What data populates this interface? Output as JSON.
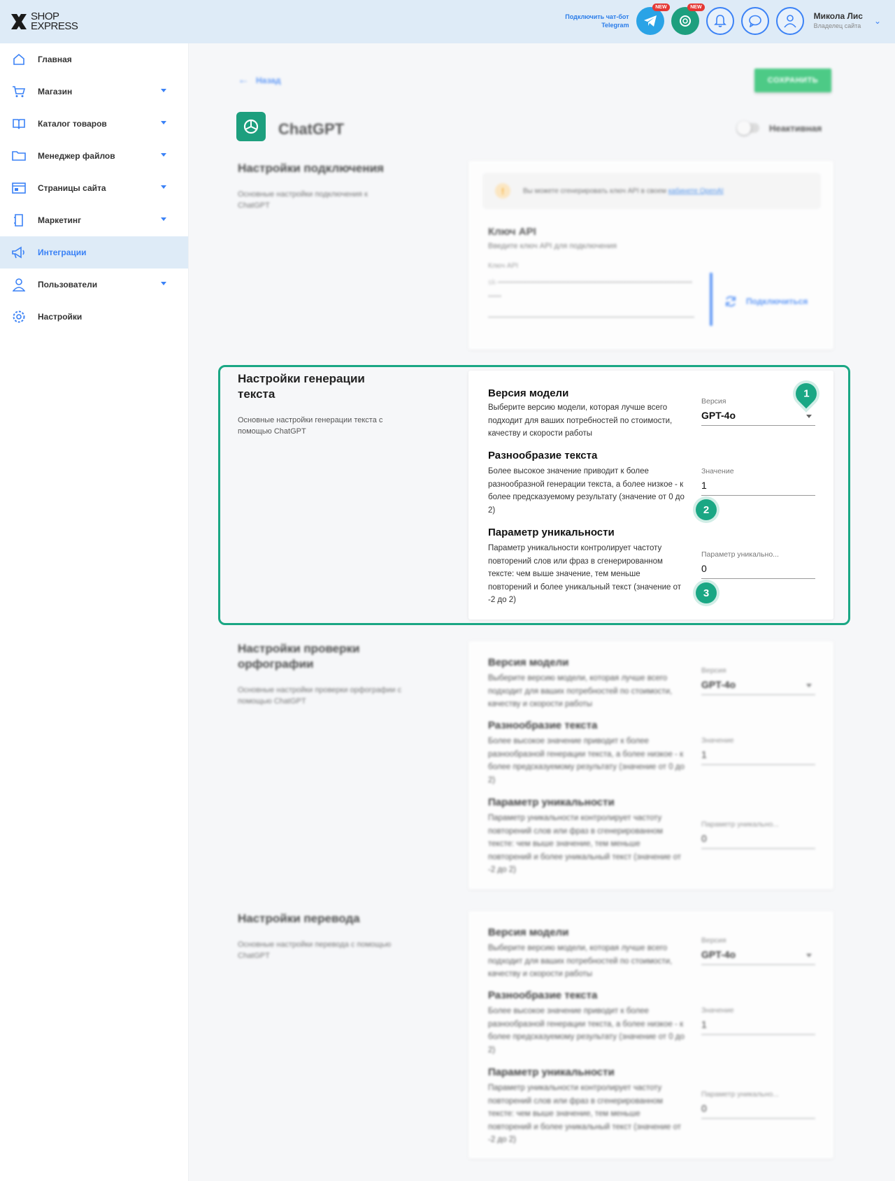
{
  "header": {
    "logo": "SHOP EXPRESS",
    "telegram_link": "Подключить чат-бот Telegram",
    "badge_new": "NEW",
    "user_name": "Микола Лис",
    "user_role": "Владелец сайта"
  },
  "sidebar": {
    "items": [
      {
        "label": "Главная",
        "icon": "home-icon"
      },
      {
        "label": "Магазин",
        "icon": "cart-icon"
      },
      {
        "label": "Каталог товаров",
        "icon": "catalog-icon"
      },
      {
        "label": "Менеджер файлов",
        "icon": "folder-icon"
      },
      {
        "label": "Страницы сайта",
        "icon": "page-icon"
      },
      {
        "label": "Маркетинг",
        "icon": "marketing-icon"
      },
      {
        "label": "Интеграции",
        "icon": "integration-icon"
      },
      {
        "label": "Пользователи",
        "icon": "users-icon"
      },
      {
        "label": "Настройки",
        "icon": "settings-icon"
      }
    ]
  },
  "page": {
    "back_label": "Назад",
    "save_label": "СОХРАНИТЬ",
    "app_title": "ChatGPT",
    "status_label": "Неактивная",
    "accent_color": "#1aa784"
  },
  "connection": {
    "title": "Настройки подключения",
    "desc": "Основные настройки подключения к ChatGPT",
    "info_text": "Вы можете сгенерировать ключ API в своем",
    "info_link": "кабинете OpenAI",
    "api_title": "Ключ API",
    "api_sub": "Введите ключ API для подключения",
    "api_label": "Ключ API",
    "api_value": "sk-•••••••••••••••••••••••••••••••••••••••••••••••••••••••••••••••••••••••••••••",
    "connect_label": "Подключиться"
  },
  "generation": {
    "title": "Настройки генерации текста",
    "desc": "Основные настройки генерации текста с помощью ChatGPT",
    "model_title": "Версия модели",
    "model_desc": "Выберите версию модели, которая лучше всего подходит для ваших потребностей по стоимости, качеству и скорости работы",
    "model_label": "Версия",
    "model_value": "GPT-4o",
    "div_title": "Разнообразие текста",
    "div_desc": "Более высокое значение приводит к более разнообразной генерации текста, а более низкое - к более предсказуемому результату (значение от 0 до 2)",
    "div_label": "Значение",
    "div_value": "1",
    "uniq_title": "Параметр уникальности",
    "uniq_desc": "Параметр уникальности контролирует частоту повторений слов или фраз в сгенерированном тексте: чем выше значение, тем меньше повторений и более уникальный текст (значение от -2 до 2)",
    "uniq_label": "Параметр уникально...",
    "uniq_value": "0",
    "markers": [
      "1",
      "2",
      "3"
    ]
  },
  "spelling": {
    "title": "Настройки проверки орфографии",
    "desc": "Основные настройки проверки орфографии с помощью ChatGPT",
    "model_title": "Версия модели",
    "model_desc": "Выберите версию модели, которая лучше всего подходит для ваших потребностей по стоимости, качеству и скорости работы",
    "model_label": "Версия",
    "model_value": "GPT-4o",
    "div_title": "Разнообразие текста",
    "div_desc": "Более высокое значение приводит к более разнообразной генерации текста, а более низкое - к более предсказуемому результату (значение от 0 до 2)",
    "div_label": "Значение",
    "div_value": "1",
    "uniq_title": "Параметр уникальности",
    "uniq_desc": "Параметр уникальности контролирует частоту повторений слов или фраз в сгенерированном тексте: чем выше значение, тем меньше повторений и более уникальный текст (значение от -2 до 2)",
    "uniq_label": "Параметр уникально...",
    "uniq_value": "0"
  },
  "translation": {
    "title": "Настройки перевода",
    "desc": "Основные настройки перевода с помощью ChatGPT",
    "model_title": "Версия модели",
    "model_desc": "Выберите версию модели, которая лучше всего подходит для ваших потребностей по стоимости, качеству и скорости работы",
    "model_label": "Версия",
    "model_value": "GPT-4o",
    "div_title": "Разнообразие текста",
    "div_desc": "Более высокое значение приводит к более разнообразной генерации текста, а более низкое - к более предсказуемому результату (значение от 0 до 2)",
    "div_label": "Значение",
    "div_value": "1",
    "uniq_title": "Параметр уникальности",
    "uniq_desc": "Параметр уникальности контролирует частоту повторений слов или фраз в сгенерированном тексте: чем выше значение, тем меньше повторений и более уникальный текст (значение от -2 до 2)",
    "uniq_label": "Параметр уникально...",
    "uniq_value": "0"
  }
}
